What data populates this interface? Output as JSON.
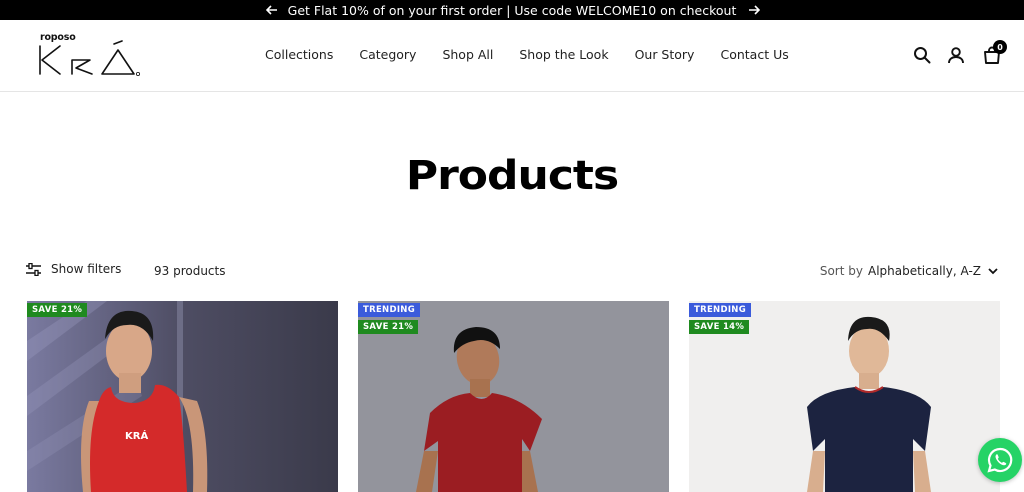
{
  "announcement": {
    "text": "Get Flat 10% of on your first order | Use code WELCOME10 on checkout"
  },
  "brand": {
    "sub": "roposo",
    "name": "KRA"
  },
  "nav": [
    "Collections",
    "Category",
    "Shop All",
    "Shop the Look",
    "Our Story",
    "Contact Us"
  ],
  "header_icons": [
    "search-icon",
    "account-icon",
    "cart-icon"
  ],
  "cart": {
    "count": "0"
  },
  "page": {
    "title": "Products"
  },
  "toolbar": {
    "filters_label": "Show filters",
    "product_count": "93 products",
    "sort_label": "Sort by",
    "sort_value": "Alphabetically, A-Z"
  },
  "products": [
    {
      "badges": [
        {
          "text": "SAVE 21%",
          "type": "save"
        }
      ],
      "shirt_color": "#d42a2a",
      "bg": "#5b5a70"
    },
    {
      "badges": [
        {
          "text": "TRENDING",
          "type": "trend"
        },
        {
          "text": "SAVE 21%",
          "type": "save"
        }
      ],
      "shirt_color": "#9b1d22",
      "bg": "#8d8e97"
    },
    {
      "badges": [
        {
          "text": "TRENDING",
          "type": "trend"
        },
        {
          "text": "SAVE 14%",
          "type": "save"
        }
      ],
      "shirt_color": "#1c2340",
      "bg": "#f0efee"
    }
  ],
  "colors": {
    "save": "#1f8a1f",
    "trend": "#3b5bdb",
    "whatsapp": "#25d366"
  }
}
